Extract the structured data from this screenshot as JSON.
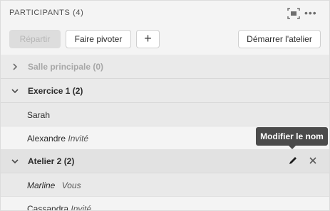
{
  "header": {
    "title": "PARTICIPANTS (4)",
    "more_label": "•••"
  },
  "toolbar": {
    "repartir_label": "Répartir",
    "pivoter_label": "Faire pivoter",
    "add_label": "+",
    "start_label": "Démarrer l'atelier"
  },
  "groups": [
    {
      "label": "Salle principale (0)",
      "expanded": false
    },
    {
      "label": "Exercice 1 (2)",
      "expanded": true
    },
    {
      "label": "Atelier 2 (2)",
      "expanded": true
    }
  ],
  "members": [
    {
      "name": "Sarah",
      "tag": ""
    },
    {
      "name": "Alexandre",
      "tag": "Invité"
    },
    {
      "name": "Marline",
      "tag": "Vous"
    },
    {
      "name": "Cassandra",
      "tag": "Invité"
    }
  ],
  "tooltip": {
    "text": "Modifier le nom"
  },
  "icons": {
    "grid": "grid-view-icon",
    "more": "more-options-icon",
    "chevron_right": "chevron-right-icon",
    "chevron_down": "chevron-down-icon",
    "edit": "pencil-icon",
    "close": "close-icon"
  }
}
